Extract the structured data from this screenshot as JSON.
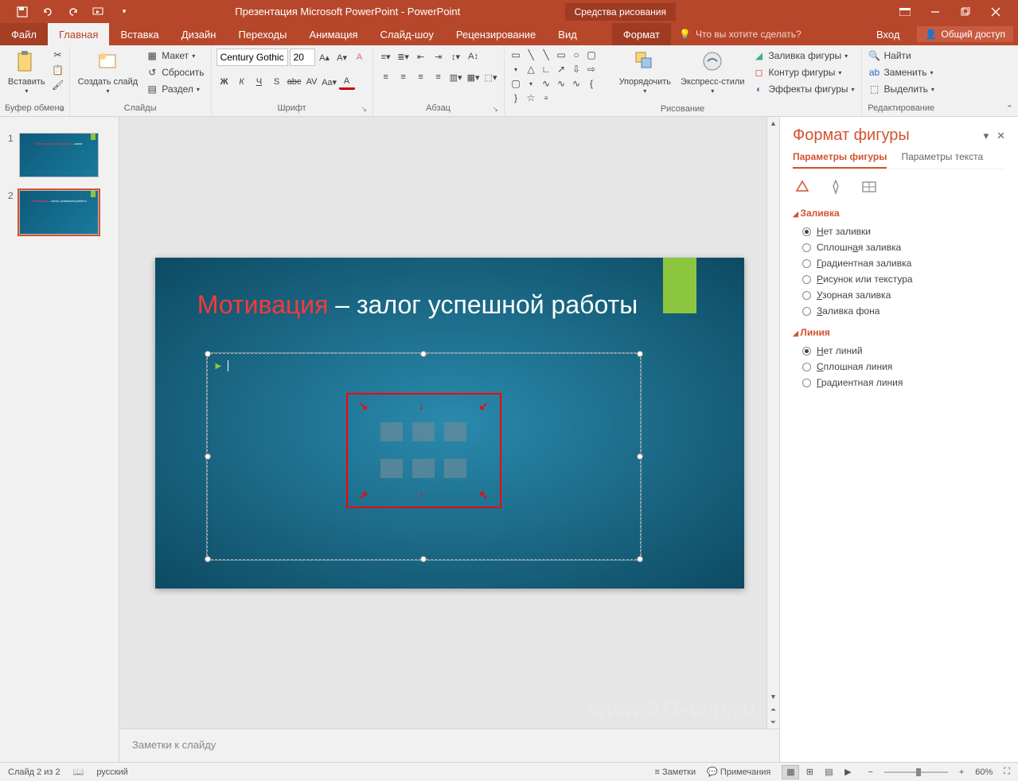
{
  "titlebar": {
    "app_title": "Презентация Microsoft PowerPoint - PowerPoint",
    "drawing_tools": "Средства рисования"
  },
  "tabs": {
    "file": "Файл",
    "home": "Главная",
    "insert": "Вставка",
    "design": "Дизайн",
    "transitions": "Переходы",
    "animation": "Анимация",
    "slideshow": "Слайд-шоу",
    "review": "Рецензирование",
    "view": "Вид",
    "format": "Формат",
    "tellme": "Что вы хотите сделать?",
    "signin": "Вход",
    "share": "Общий доступ"
  },
  "ribbon": {
    "clipboard": {
      "paste": "Вставить",
      "label": "Буфер обмена"
    },
    "slides": {
      "new_slide": "Создать слайд",
      "layout": "Макет",
      "reset": "Сбросить",
      "section": "Раздел",
      "label": "Слайды"
    },
    "font": {
      "name": "Century Gothic",
      "size": "20",
      "label": "Шрифт"
    },
    "paragraph": {
      "label": "Абзац"
    },
    "drawing": {
      "arrange": "Упорядочить",
      "quick_styles": "Экспресс-стили",
      "shape_fill": "Заливка фигуры",
      "shape_outline": "Контур фигуры",
      "shape_effects": "Эффекты фигуры",
      "label": "Рисование"
    },
    "editing": {
      "find": "Найти",
      "replace": "Заменить",
      "select": "Выделить",
      "label": "Редактирование"
    }
  },
  "thumbs": {
    "n1": "1",
    "n2": "2"
  },
  "slide": {
    "title_red": "Мотивация",
    "title_rest": " – залог успешной работы"
  },
  "notes": {
    "placeholder": "Заметки к слайду"
  },
  "pane": {
    "title": "Формат фигуры",
    "tab_shape": "Параметры фигуры",
    "tab_text": "Параметры текста",
    "fill_header": "Заливка",
    "fill_none": "Нет заливки",
    "fill_solid": "Сплошная заливка",
    "fill_gradient": "Градиентная заливка",
    "fill_picture": "Рисунок или текстура",
    "fill_pattern": "Узорная заливка",
    "fill_bg": "Заливка фона",
    "line_header": "Линия",
    "line_none": "Нет линий",
    "line_solid": "Сплошная линия",
    "line_gradient": "Градиентная линия"
  },
  "status": {
    "slide_count": "Слайд 2 из 2",
    "language": "русский",
    "notes_btn": "Заметки",
    "comments_btn": "Примечания",
    "zoom": "60%"
  },
  "watermark": "www.911-win.ru"
}
